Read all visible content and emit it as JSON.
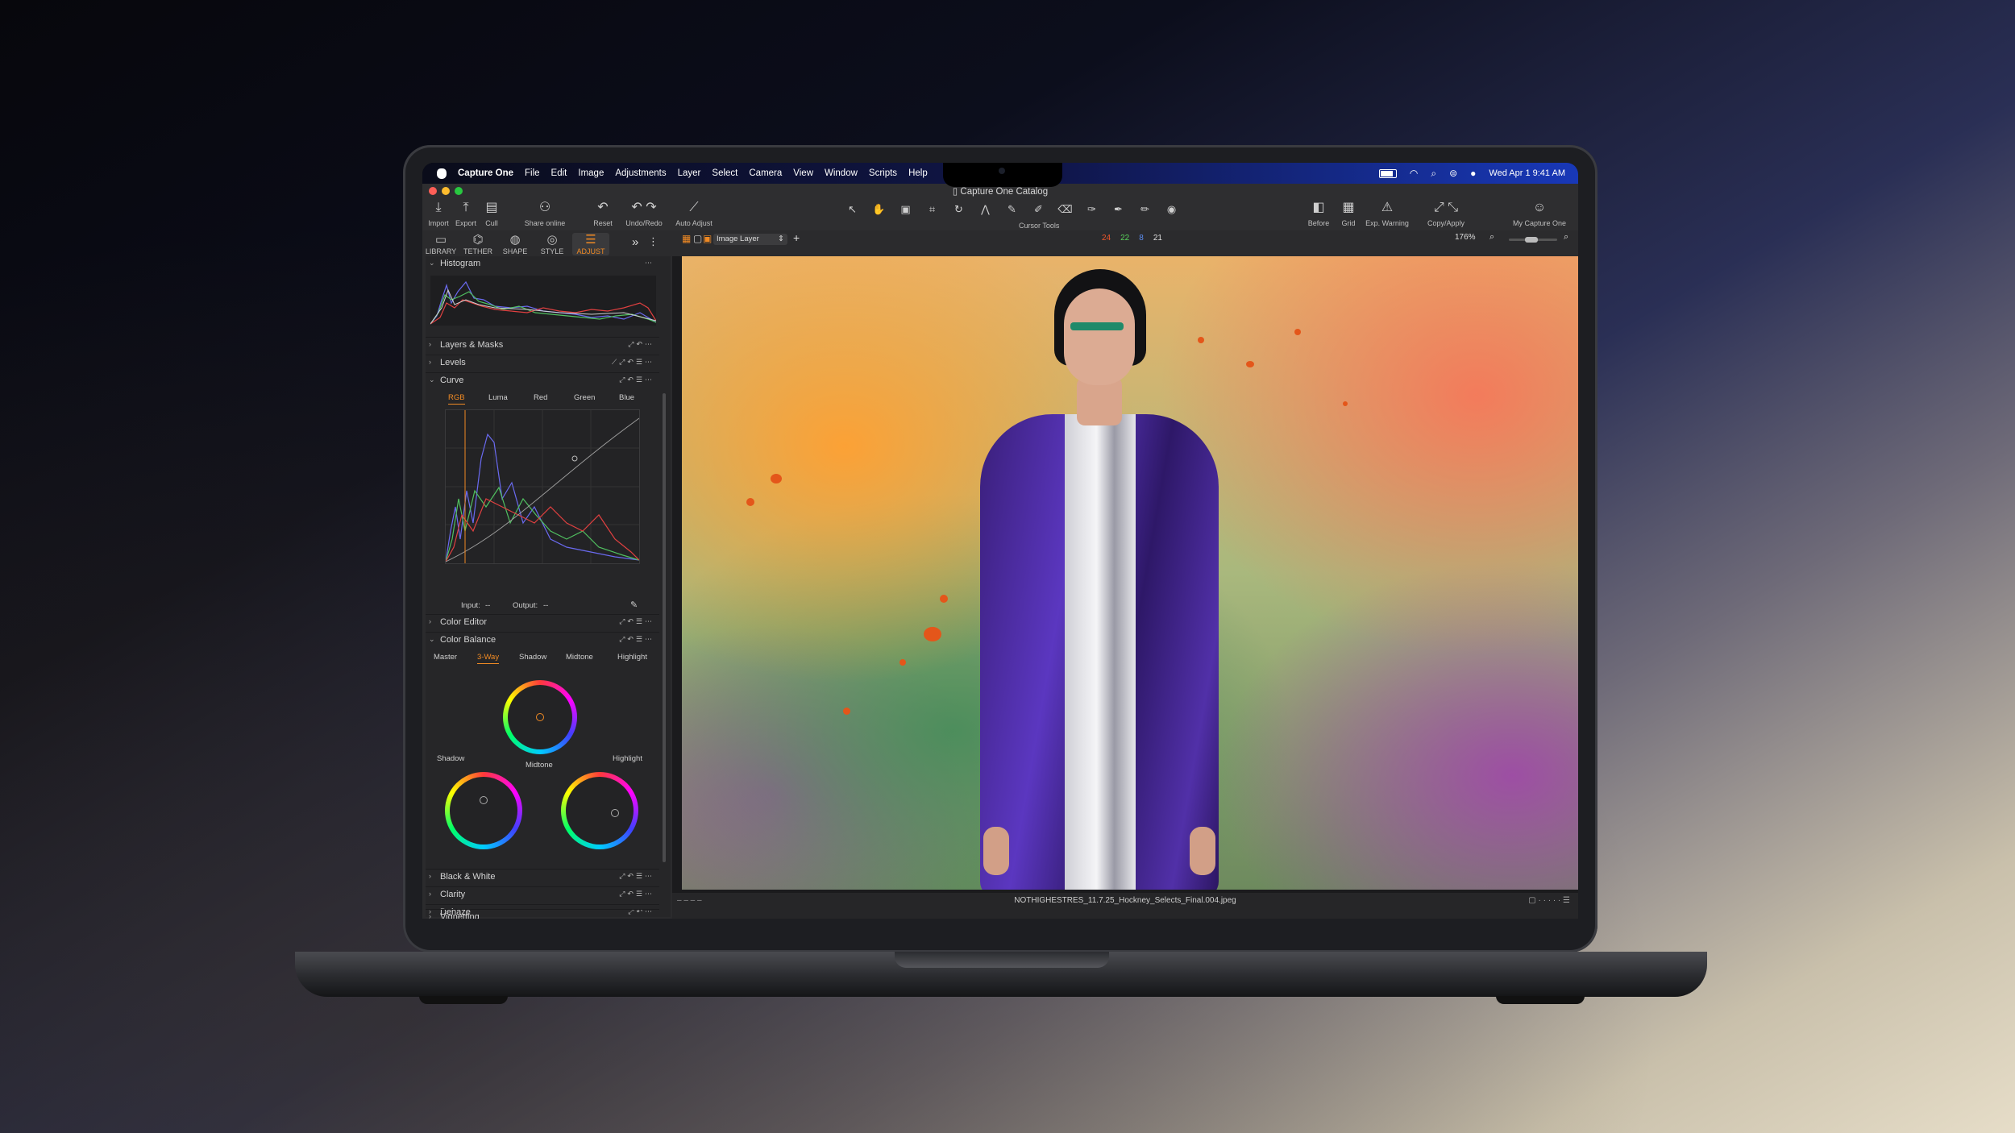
{
  "menubar": {
    "app": "Capture One",
    "items": [
      "File",
      "Edit",
      "Image",
      "Adjustments",
      "Layer",
      "Select",
      "Camera",
      "View",
      "Window",
      "Scripts",
      "Help"
    ],
    "datetime": "Wed Apr 1  9:41 AM"
  },
  "window": {
    "title": "Capture One Catalog"
  },
  "toolbar": {
    "left": [
      {
        "label": "Import",
        "icon": "import-icon"
      },
      {
        "label": "Export",
        "icon": "export-icon"
      },
      {
        "label": "Cull",
        "icon": "cull-icon"
      },
      {
        "label": "Share online",
        "icon": "share-online-icon"
      },
      {
        "label": "Reset",
        "icon": "reset-icon"
      },
      {
        "label": "Undo/Redo",
        "icon": "undo-redo-icon"
      },
      {
        "label": "Auto Adjust",
        "icon": "auto-adjust-icon"
      }
    ],
    "cursor_tools_label": "Cursor Tools",
    "right": [
      {
        "label": "Before",
        "icon": "before-icon"
      },
      {
        "label": "Grid",
        "icon": "grid-icon"
      },
      {
        "label": "Exp. Warning",
        "icon": "exposure-warning-icon"
      },
      {
        "label": "Copy/Apply",
        "icon": "copy-apply-icon"
      },
      {
        "label": "My Capture One",
        "icon": "account-icon"
      }
    ]
  },
  "tool_tabs": [
    {
      "label": "LIBRARY",
      "icon": "library-icon"
    },
    {
      "label": "TETHER",
      "icon": "tether-icon"
    },
    {
      "label": "SHAPE",
      "icon": "shape-icon"
    },
    {
      "label": "STYLE",
      "icon": "style-icon"
    },
    {
      "label": "ADJUST",
      "icon": "adjust-icon",
      "active": true
    }
  ],
  "viewer_bar": {
    "layer": "Image Layer",
    "counts": [
      {
        "value": "24",
        "color": "#f0562a"
      },
      {
        "value": "22",
        "color": "#58d05a"
      },
      {
        "value": "8",
        "color": "#5a8cf0"
      },
      {
        "value": "21",
        "color": "#dddddd"
      }
    ],
    "zoom": "176%"
  },
  "panel": {
    "histogram": "Histogram",
    "layers_masks": "Layers & Masks",
    "levels": "Levels",
    "curve": "Curve",
    "curve_tabs": [
      "RGB",
      "Luma",
      "Red",
      "Green",
      "Blue"
    ],
    "curve_active": "RGB",
    "input_label": "Input:",
    "input_value": "--",
    "output_label": "Output:",
    "output_value": "--",
    "color_editor": "Color Editor",
    "color_balance": "Color Balance",
    "balance_tabs": [
      "Master",
      "3-Way",
      "Shadow",
      "Midtone",
      "Highlight"
    ],
    "balance_active": "3-Way",
    "wheel_labels": {
      "midtone": "Midtone",
      "shadow": "Shadow",
      "highlight": "Highlight"
    },
    "black_white": "Black & White",
    "clarity": "Clarity",
    "dehaze": "Dehaze",
    "vignetting": "Vignetting"
  },
  "status": {
    "filename": "NOTHIGHESTRES_11.7.25_Hockney_Selects_Final.004.jpeg"
  },
  "colors": {
    "accent": "#f08a24"
  }
}
